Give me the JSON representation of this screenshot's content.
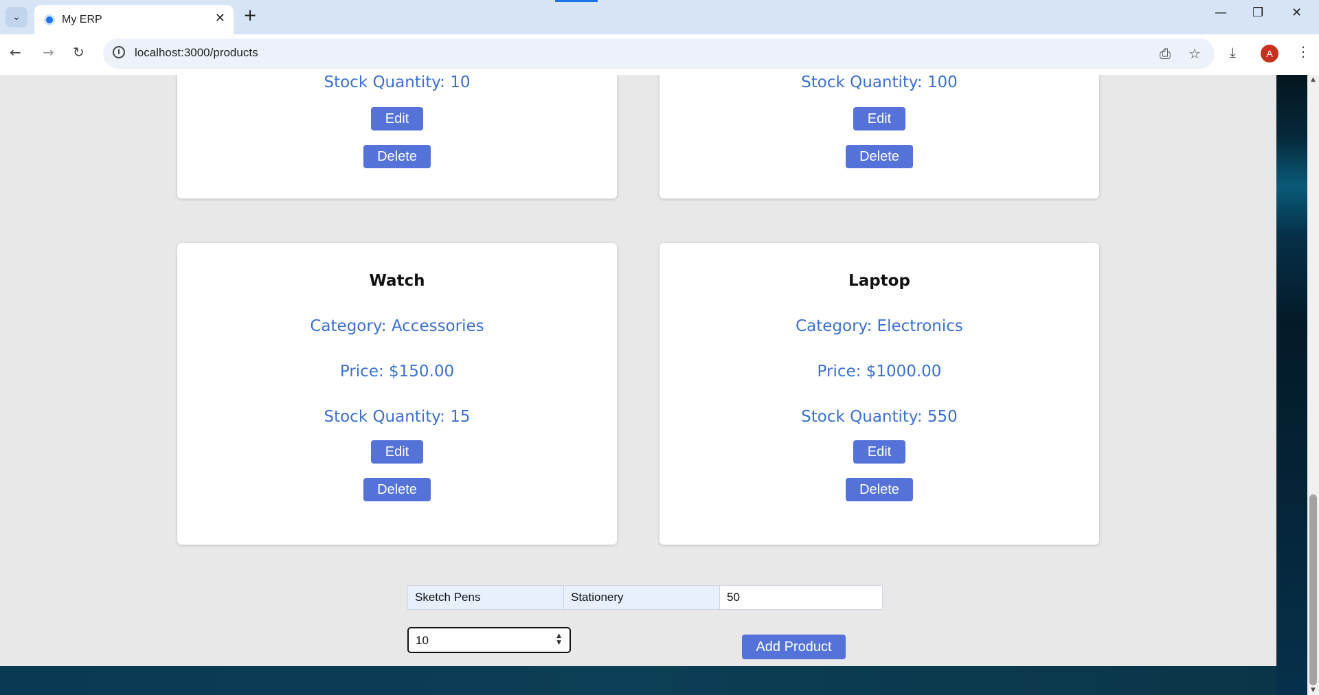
{
  "browser": {
    "tab_title": "My ERP",
    "url": "localhost:3000/products",
    "avatar_letter": "A"
  },
  "products": [
    {
      "name": "",
      "category": "",
      "price": "",
      "stock": "Stock Quantity: 10",
      "edit_label": "Edit",
      "delete_label": "Delete"
    },
    {
      "name": "",
      "category": "",
      "price": "",
      "stock": "Stock Quantity: 100",
      "edit_label": "Edit",
      "delete_label": "Delete"
    },
    {
      "name": "Watch",
      "category": "Category: Accessories",
      "price": "Price: $150.00",
      "stock": "Stock Quantity: 15",
      "edit_label": "Edit",
      "delete_label": "Delete"
    },
    {
      "name": "Laptop",
      "category": "Category: Electronics",
      "price": "Price: $1000.00",
      "stock": "Stock Quantity: 550",
      "edit_label": "Edit",
      "delete_label": "Delete"
    }
  ],
  "form": {
    "name_value": "Sketch Pens",
    "category_value": "Stationery",
    "price_value": "50",
    "stock_value": "10",
    "add_label": "Add Product"
  }
}
